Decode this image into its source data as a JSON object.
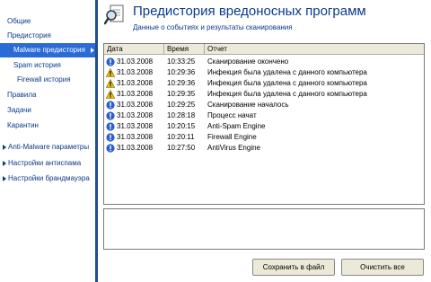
{
  "sidebar": {
    "items": [
      {
        "label": "Общие"
      },
      {
        "label": "Предистория"
      },
      {
        "label": "Malware предистория"
      },
      {
        "label": "Spam история"
      },
      {
        "label": "Firewall история"
      },
      {
        "label": "Правила"
      },
      {
        "label": "Задачи"
      },
      {
        "label": "Карантин"
      },
      {
        "label": "Anti-Malware  параметры"
      },
      {
        "label": "Настройки антиспама"
      },
      {
        "label": "Настройки брандмауэра"
      }
    ]
  },
  "header": {
    "icon": "magnifier-document-icon",
    "title": "Предистория вредоносных программ",
    "subtitle": "Данные о событиях и результаты сканирования"
  },
  "log": {
    "columns": [
      "Дата",
      "Время",
      "Отчет"
    ],
    "rows": [
      {
        "icon": "info-icon",
        "date": "31.03.2008",
        "time": "10:33:25",
        "report": "Сканирование окончено"
      },
      {
        "icon": "warning-icon",
        "date": "31.03.2008",
        "time": "10:29:36",
        "report": "Инфекция была удалена с данного компьютера"
      },
      {
        "icon": "warning-icon",
        "date": "31.03.2008",
        "time": "10:29:36",
        "report": "Инфекция была удалена с данного компьютера"
      },
      {
        "icon": "warning-icon",
        "date": "31.03.2008",
        "time": "10:29:35",
        "report": "Инфекция была удалена с данного компьютера"
      },
      {
        "icon": "info-icon",
        "date": "31.03.2008",
        "time": "10:29:25",
        "report": "Сканирование началось"
      },
      {
        "icon": "info-icon",
        "date": "31.03.2008",
        "time": "10:28:18",
        "report": "Процесс начат"
      },
      {
        "icon": "info-icon",
        "date": "31.03.2008",
        "time": "10:20:15",
        "report": "Anti-Spam Engine"
      },
      {
        "icon": "info-icon",
        "date": "31.03.2008",
        "time": "10:20:11",
        "report": "Firewall Engine"
      },
      {
        "icon": "info-icon",
        "date": "31.03.2008",
        "time": "10:27:50",
        "report": "AntiVirus Engine"
      }
    ]
  },
  "buttons": {
    "save": "Сохранить в файл",
    "clear": "Очистить все"
  },
  "colors": {
    "accent": "#0a3a8c",
    "selection": "#2a6bd6",
    "info": "#2a5fd0",
    "warning": "#f2c200"
  }
}
